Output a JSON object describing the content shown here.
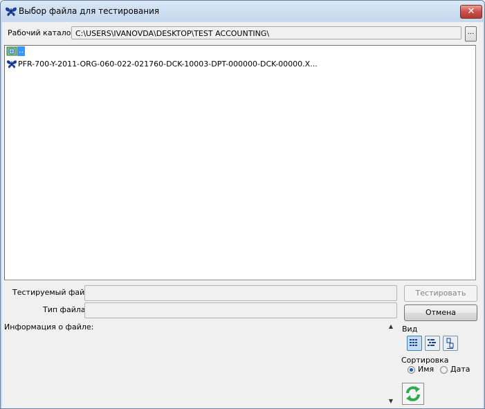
{
  "window": {
    "title": "Выбор файла для тестирования",
    "close_glyph": "✕",
    "icon": "butterfly-icon"
  },
  "workdir": {
    "label": "Рабочий каталог",
    "path": "C:\\USERS\\IVANOVDA\\DESKTOP\\TEST ACCOUNTING\\",
    "browse_label": "..."
  },
  "file_list": {
    "items": [
      {
        "icon": "parent-folder-icon",
        "name": "..",
        "selected": true
      },
      {
        "icon": "butterfly-icon",
        "name": "PFR-700-Y-2011-ORG-060-022-021760-DCK-10003-DPT-000000-DCK-00000.X...",
        "selected": false
      }
    ]
  },
  "tested_file": {
    "label": "Тестируемый файл:",
    "value": ""
  },
  "file_type": {
    "label": "Тип файла:",
    "value": ""
  },
  "file_info": {
    "label": "Информация о файле:"
  },
  "buttons": {
    "test": "Тестировать",
    "cancel": "Отмена"
  },
  "view": {
    "label": "Вид",
    "modes": [
      "details-view-icon",
      "list-view-icon",
      "icons-view-icon"
    ],
    "active": 0
  },
  "sort": {
    "label": "Сортировка",
    "options": [
      "Имя",
      "Дата"
    ],
    "selected": "Имя"
  },
  "colors": {
    "selection": "#3399ff",
    "refresh_green": "#2fa84f"
  }
}
